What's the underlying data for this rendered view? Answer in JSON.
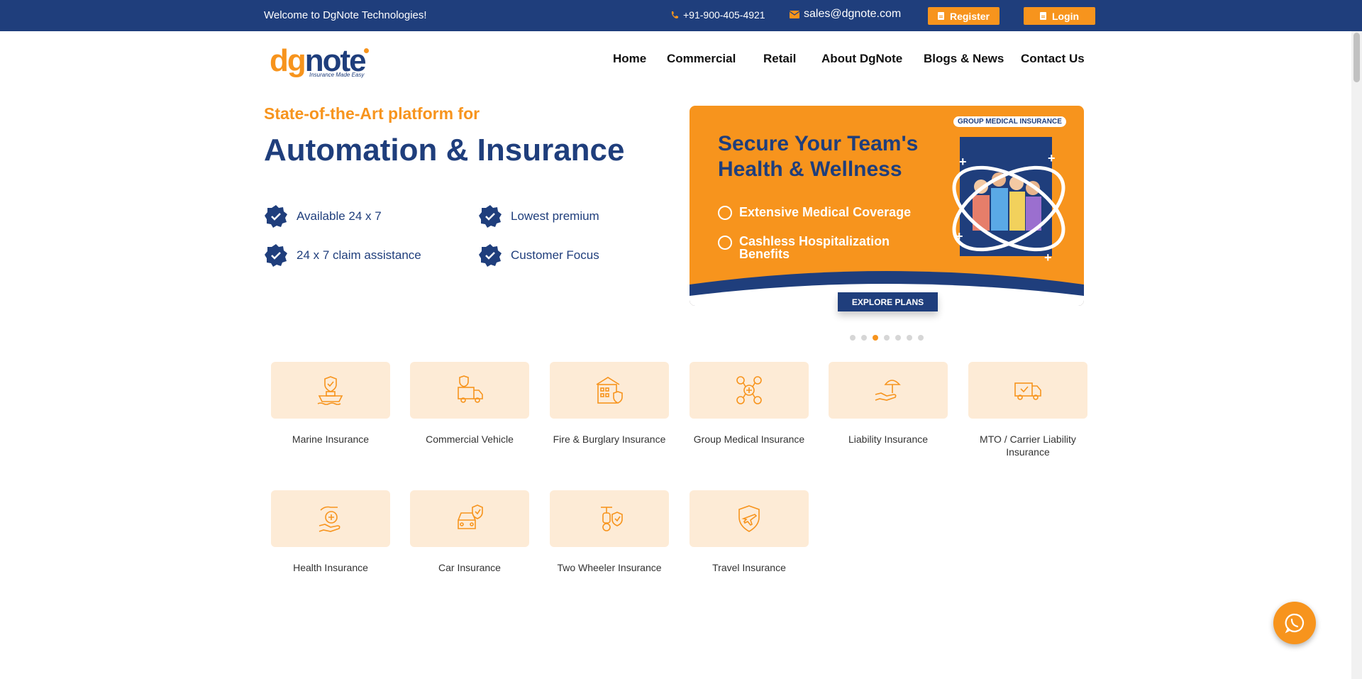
{
  "topbar": {
    "welcome": "Welcome to DgNote Technologies!",
    "phone": "+91-900-405-4921",
    "email": "sales@dgnote.com",
    "register": "Register",
    "login": "Login",
    "icons": [
      "phone-icon",
      "mail-icon",
      "document-icon"
    ]
  },
  "logo": {
    "dg": "dg",
    "note": "note",
    "tagline": "Insurance Made Easy"
  },
  "nav": [
    "Home",
    "Commercial",
    "Retail",
    "About DgNote",
    "Blogs & News",
    "Contact Us"
  ],
  "hero": {
    "subtitle": "State-of-the-Art platform for",
    "title": "Automation & Insurance",
    "features": [
      "Available 24 x 7",
      "Lowest premium",
      "24 x 7 claim assistance",
      "Customer Focus"
    ]
  },
  "banner": {
    "tag": "GROUP MEDICAL INSURANCE",
    "headline_1": "Secure Your Team's",
    "headline_2": "Health & Wellness",
    "point_1": "Extensive Medical Coverage",
    "point_2a": "Cashless Hospitalization",
    "point_2b": "Benefits",
    "cta": "EXPLORE PLANS",
    "slides": 7,
    "active_slide": 3
  },
  "categories": [
    {
      "label": "Marine Insurance",
      "icon": "ship-shield-icon"
    },
    {
      "label": "Commercial Vehicle",
      "icon": "truck-shield-icon"
    },
    {
      "label": "Fire & Burglary Insurance",
      "icon": "building-shield-icon"
    },
    {
      "label": "Group Medical Insurance",
      "icon": "group-medical-icon"
    },
    {
      "label": "Liability Insurance",
      "icon": "hand-umbrella-icon"
    },
    {
      "label": "MTO / Carrier Liability Insurance",
      "icon": "carrier-truck-icon"
    },
    {
      "label": "Health Insurance",
      "icon": "hand-health-icon"
    },
    {
      "label": "Car Insurance",
      "icon": "car-shield-icon"
    },
    {
      "label": "Two Wheeler Insurance",
      "icon": "scooter-shield-icon"
    },
    {
      "label": "Travel Insurance",
      "icon": "plane-shield-icon"
    }
  ],
  "colors": {
    "navy": "#1f3e7c",
    "orange": "#f7941d",
    "tile": "#fdebd6"
  }
}
